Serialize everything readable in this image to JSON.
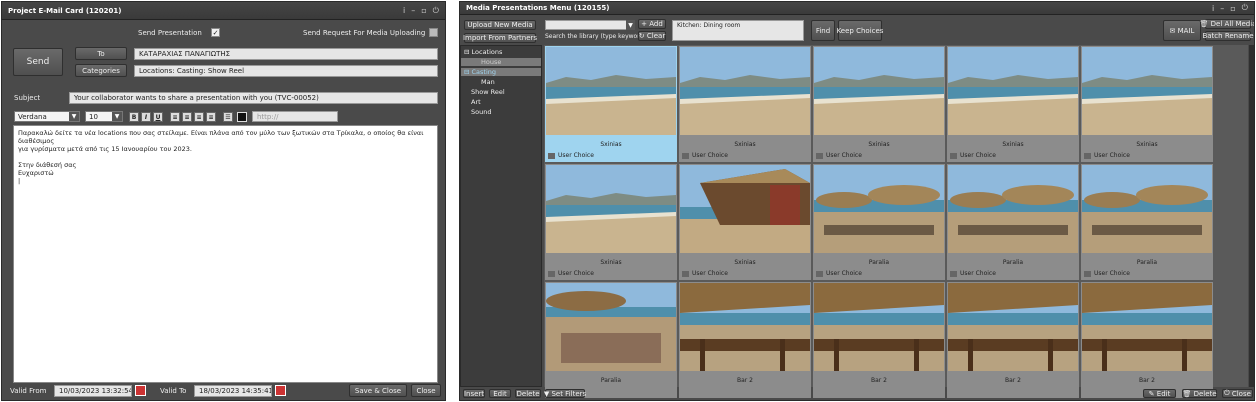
{
  "email_card": {
    "title": "Project E-Mail Card (120201)",
    "send_presentation_label": "Send Presentation",
    "send_presentation_checked": true,
    "send_request_label": "Send Request For Media Uploading",
    "send_request_checked": false,
    "send_button": "Send",
    "to_button": "To",
    "to_value": "ΚΑΤΑΡΑΧΙΑΣ ΠΑΝΑΓΙΩΤΗΣ",
    "categories_button": "Categories",
    "categories_value": "Locations: Casting: Show Reel",
    "subject_label": "Subject",
    "subject_value": "Your collaborator wants to share a presentation with you (TVC-00052)",
    "font_family": "Verdana",
    "font_size": "10",
    "link_placeholder": "http://",
    "body_lines": [
      "Παρακαλώ δείτε τα νέα locations που σας στείλαμε. Είναι πλάνα από τον μύλο των ξωτικών στα Τρίκαλα, ο οποίος θα είναι διαθέσιμος",
      "για γυρίσματα μετά από τις 15 Ιανουαρίου του 2023.",
      "",
      "Στην διάθεσή σας",
      "Ευχαριστώ"
    ],
    "valid_from_label": "Valid From",
    "valid_from_value": "10/03/2023 13:32:54",
    "valid_to_label": "Valid To",
    "valid_to_value": "18/03/2023 14:35:41",
    "save_close_button": "Save & Close",
    "close_button": "Close"
  },
  "media_menu": {
    "title": "Media Presentations Menu (120155)",
    "upload_button": "Upload New Media",
    "import_button": "Import From Partners",
    "search_hint": "Search the library (type keyword)",
    "add_button": "Add",
    "clear_button": "Clear",
    "keywords_value": "Kitchen: Dining room",
    "find_button": "Find",
    "keep_choices_button": "Keep Choices",
    "mail_button": "MAIL",
    "del_all_button": "Del All Media",
    "batch_rename_button": "Batch Rename",
    "tree": [
      {
        "label": "Locations",
        "level": 0,
        "selected": false
      },
      {
        "label": "House",
        "level": 1,
        "selected": true
      },
      {
        "label": "Casting",
        "level": 0,
        "selected": true
      },
      {
        "label": "Man",
        "level": 1,
        "selected": false
      },
      {
        "label": "Show Reel",
        "level": 0,
        "selected": false
      },
      {
        "label": "Art",
        "level": 0,
        "selected": false
      },
      {
        "label": "Sound",
        "level": 0,
        "selected": false
      }
    ],
    "tiles": [
      {
        "caption": "Sxinias",
        "choice": "User Choice",
        "scene": "beach",
        "active": true
      },
      {
        "caption": "Sxinias",
        "choice": "User Choice",
        "scene": "beach"
      },
      {
        "caption": "Sxinias",
        "choice": "User Choice",
        "scene": "beach"
      },
      {
        "caption": "Sxinias",
        "choice": "User Choice",
        "scene": "beach"
      },
      {
        "caption": "Sxinias",
        "choice": "User Choice",
        "scene": "beach"
      },
      {
        "caption": "Sxinias",
        "choice": "User Choice",
        "scene": "beach"
      },
      {
        "caption": "Sxinias",
        "choice": "User Choice",
        "scene": "hut"
      },
      {
        "caption": "Paralia",
        "choice": "User Choice",
        "scene": "umbrellas"
      },
      {
        "caption": "Paralia",
        "choice": "User Choice",
        "scene": "umbrellas"
      },
      {
        "caption": "Paralia",
        "choice": "User Choice",
        "scene": "umbrellas"
      },
      {
        "caption": "Paralia",
        "choice": "",
        "scene": "crowd"
      },
      {
        "caption": "Bar 2",
        "choice": "",
        "scene": "bar"
      },
      {
        "caption": "Bar 2",
        "choice": "",
        "scene": "bar"
      },
      {
        "caption": "Bar 2",
        "choice": "",
        "scene": "bar"
      },
      {
        "caption": "Bar 2",
        "choice": "",
        "scene": "bar"
      }
    ],
    "bottom_left": [
      "Insert",
      "Edit",
      "Delete",
      "Set Filters"
    ],
    "bottom_right": [
      "Edit",
      "Delete",
      "Close"
    ]
  }
}
